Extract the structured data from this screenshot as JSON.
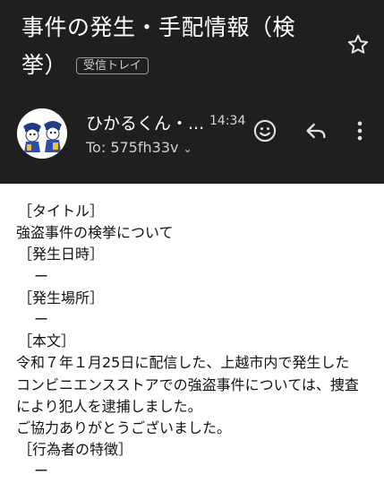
{
  "email": {
    "subject_line1": "事件の発生・手配情報（検",
    "subject_line2": "挙）",
    "label": "受信トレイ",
    "sender": "ひかるくん・...",
    "time": "14:34",
    "to": "To: 575fh33v",
    "to_chevron": "⌄"
  },
  "icons": {
    "star": "star-icon",
    "emoji": "emoji-smile-icon",
    "reply": "reply-icon",
    "more": "more-vert-icon",
    "avatar": "avatar-mascot"
  },
  "body": {
    "title_label": "［タイトル］",
    "title": "強盗事件の検挙について",
    "datetime_label": "［発生日時］",
    "datetime": "ー",
    "place_label": "［発生場所］",
    "place": "ー",
    "content_label": "［本文］",
    "content_1": "令和７年１月25日に配信した、上越市内で発生した",
    "content_2": "コンビニエンスストアでの強盗事件については、捜査",
    "content_3": "により犯人を逮捕しました。",
    "content_4": "ご協力ありがとうございました。",
    "features_label": "［行為者の特徴］",
    "features": "ー"
  },
  "colors": {
    "header_bg": "#1f1f1f",
    "body_bg": "#ffffff",
    "text_light": "#ffffff",
    "text_dark": "#111111"
  }
}
